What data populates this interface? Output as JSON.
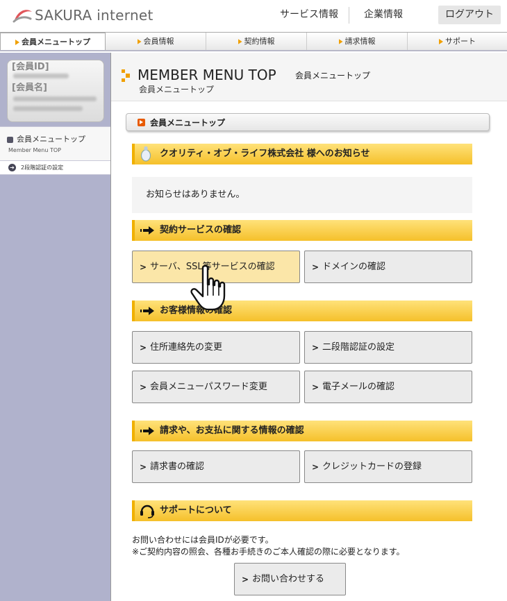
{
  "header": {
    "logo_text": "SAKURA internet",
    "links": [
      "サービス情報",
      "企業情報"
    ],
    "logout_label": "ログアウト"
  },
  "topnav": {
    "tabs": [
      "会員メニュートップ",
      "会員情報",
      "契約情報",
      "請求情報",
      "サポート"
    ],
    "active_index": 0
  },
  "sidebar": {
    "member_id_label": "[会員ID]",
    "member_name_label": "[会員名]",
    "nav_title_ja": "会員メニュートップ",
    "nav_title_en": "Member Menu TOP",
    "sub_item": "2段階認証の設定"
  },
  "main": {
    "title_en": "MEMBER MENU TOP",
    "title_ja_side": "会員メニュートップ",
    "title_ja": "会員メニュートップ",
    "breadcrumb": "会員メニュートップ",
    "notice": {
      "title": "クオリティ・オブ・ライフ株式会社 様へのお知らせ",
      "text": "お知らせはありません。"
    },
    "contract": {
      "title": "契約サービスの確認",
      "buttons": [
        "サーバ、SSL等サービスの確認",
        "ドメインの確認"
      ]
    },
    "customer": {
      "title": "お客様情報の確認",
      "buttons": [
        "住所連絡先の変更",
        "二段階認証の設定",
        "会員メニューパスワード変更",
        "電子メールの確認"
      ]
    },
    "billing": {
      "title": "請求や、お支払に関する情報の確認",
      "buttons": [
        "請求書の確認",
        "クレジットカードの登録"
      ]
    },
    "support": {
      "title": "サポートについて",
      "line1": "お問い合わせには会員IDが必要です。",
      "line2": "※ご契約内容の照会、各種お手続きのご本人確認の際に必要となります。",
      "contact_label": "お問い合わせする"
    }
  },
  "colors": {
    "section_bar": "#f5c02a",
    "sidebar_bg": "#b0b2cc",
    "hover_button": "#fbe6a8",
    "brand_red": "#e0555a"
  },
  "icons": [
    "sakura-logo-icon",
    "title-arrow-icon",
    "play-icon",
    "lightbulb-icon",
    "arrow-right-icon",
    "headset-icon",
    "chevron-right-icon",
    "hand-pointer-icon"
  ]
}
